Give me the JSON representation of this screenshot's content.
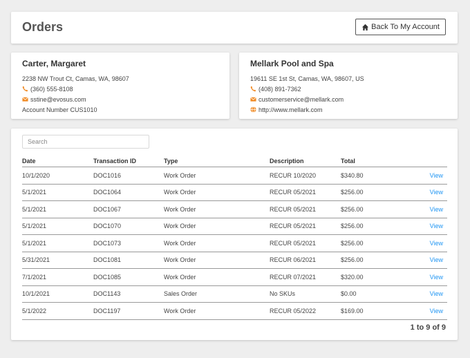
{
  "header": {
    "title": "Orders",
    "back_button_label": "Back To My Account",
    "back_icon": "home-icon"
  },
  "customer": {
    "name": "Carter, Margaret",
    "address": "2238 NW Trout Ct, Camas, WA, 98607",
    "phone": "(360) 555-8108",
    "email": "sstine@evosus.com",
    "account": "Account Number CUS1010"
  },
  "company": {
    "name": "Mellark Pool and Spa",
    "address": "19611 SE 1st St, Camas, WA, 98607, US",
    "phone": "(408) 891-7362",
    "email": "customerservice@mellark.com",
    "website": "http://www.mellark.com"
  },
  "icons": {
    "phone": "phone-icon",
    "email": "envelope-icon",
    "web": "globe-icon",
    "accent_color": "#f08a24",
    "link_color": "#2196f3"
  },
  "search": {
    "placeholder": "Search",
    "value": ""
  },
  "table": {
    "columns": [
      "Date",
      "Transaction ID",
      "Type",
      "Description",
      "Total",
      ""
    ],
    "rows": [
      {
        "date": "10/1/2020",
        "id": "DOC1016",
        "type": "Work Order",
        "desc": "RECUR 10/2020",
        "total": "$340.80",
        "action": "View"
      },
      {
        "date": "5/1/2021",
        "id": "DOC1064",
        "type": "Work Order",
        "desc": "RECUR 05/2021",
        "total": "$256.00",
        "action": "View"
      },
      {
        "date": "5/1/2021",
        "id": "DOC1067",
        "type": "Work Order",
        "desc": "RECUR 05/2021",
        "total": "$256.00",
        "action": "View"
      },
      {
        "date": "5/1/2021",
        "id": "DOC1070",
        "type": "Work Order",
        "desc": "RECUR 05/2021",
        "total": "$256.00",
        "action": "View"
      },
      {
        "date": "5/1/2021",
        "id": "DOC1073",
        "type": "Work Order",
        "desc": "RECUR 05/2021",
        "total": "$256.00",
        "action": "View"
      },
      {
        "date": "5/31/2021",
        "id": "DOC1081",
        "type": "Work Order",
        "desc": "RECUR 06/2021",
        "total": "$256.00",
        "action": "View"
      },
      {
        "date": "7/1/2021",
        "id": "DOC1085",
        "type": "Work Order",
        "desc": "RECUR 07/2021",
        "total": "$320.00",
        "action": "View"
      },
      {
        "date": "10/1/2021",
        "id": "DOC1143",
        "type": "Sales Order",
        "desc": "No SKUs",
        "total": "$0.00",
        "action": "View"
      },
      {
        "date": "5/1/2022",
        "id": "DOC1197",
        "type": "Work Order",
        "desc": "RECUR 05/2022",
        "total": "$169.00",
        "action": "View"
      }
    ]
  },
  "pager": {
    "text": "1 to 9 of 9"
  }
}
